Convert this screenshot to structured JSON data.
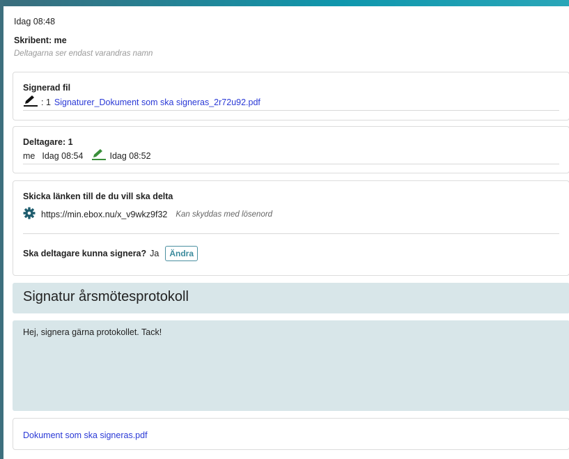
{
  "header": {
    "timestamp": "Idag 08:48",
    "author": "Skribent: me",
    "visibility_note": "Deltagarna ser endast varandras namn"
  },
  "signed_file": {
    "title": "Signerad fil",
    "count_prefix": ": 1",
    "file_link": "Signaturer_Dokument som ska signeras_2r72u92.pdf",
    "icon": "pen-icon",
    "icon_color": "#111111"
  },
  "participants": {
    "title": "Deltagare: 1",
    "items": [
      {
        "name": "me",
        "viewed_time": "Idag 08:54",
        "signed_time": "Idag 08:52",
        "signed_icon": "pen-icon",
        "signed_icon_color": "#3a8f3a"
      }
    ]
  },
  "share": {
    "title": "Skicka länken till de du vill ska delta",
    "settings_icon": "gear-icon",
    "url": "https://min.ebox.nu/x_v9wkz9f32",
    "password_note": "Kan skyddas med lösenord",
    "sign_question": "Ska deltagare kunna signera?",
    "sign_answer": "Ja",
    "change_button": "Ändra"
  },
  "subject": "Signatur årsmötesprotokoll",
  "message": "Hej, signera gärna protokollet. Tack!",
  "attachment": {
    "file_link": "Dokument som ska signeras.pdf"
  },
  "colors": {
    "accent": "#0f97ad",
    "link": "#2a39d6",
    "panel_bg": "#d8e6e9",
    "button_text": "#3c8b9d",
    "signed_green": "#3a8f3a"
  }
}
